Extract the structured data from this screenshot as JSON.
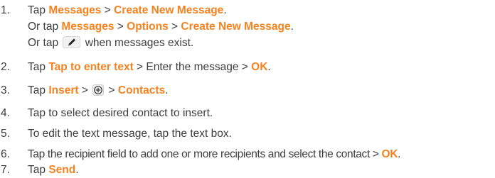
{
  "steps": [
    {
      "number": "1.",
      "lines": [
        {
          "t1": "Tap ",
          "k1": "Messages",
          "t2": " > ",
          "k2": "Create New Message",
          "t3": "."
        },
        {
          "t1": "Or tap ",
          "k1": "Messages",
          "t2": " > ",
          "k2": "Options",
          "t3": " > ",
          "k3": "Create New Message",
          "t4": "."
        },
        {
          "t1": "Or tap ",
          "icon": "pencil-icon",
          "t2": " when messages exist."
        }
      ]
    },
    {
      "number": "2.",
      "t1": "Tap ",
      "k1": "Tap to enter text",
      "t2": " > Enter the message > ",
      "k2": "OK",
      "t3": "."
    },
    {
      "number": "3.",
      "t1": "Tap ",
      "k1": "Insert",
      "t2": " > ",
      "icon": "add-circle-icon",
      "t3": " > ",
      "k2": "Contacts",
      "t4": "."
    },
    {
      "number": "4.",
      "text": "Tap to select desired contact to insert."
    },
    {
      "number": "5.",
      "text": "To edit the text message, tap the text box."
    },
    {
      "number": "6.",
      "t1": "Tap the recipient field to add one or more recipients and select the contact > ",
      "k1": "OK",
      "t2": "."
    },
    {
      "number": "7.",
      "t1": "Tap ",
      "k1": "Send",
      "t2": "."
    }
  ],
  "colors": {
    "text": "#3d3d3d",
    "keyword": "#f5821f"
  }
}
